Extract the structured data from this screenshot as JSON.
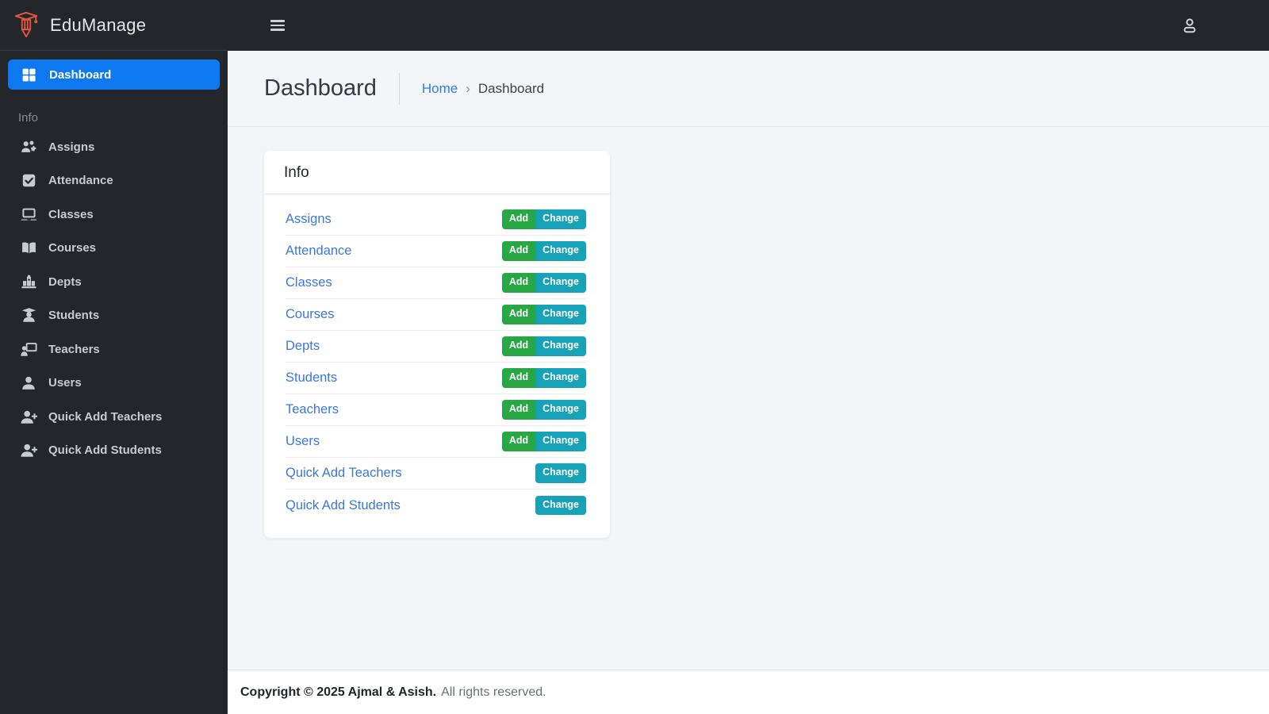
{
  "brand": {
    "name": "EduManage"
  },
  "sidebar": {
    "dashboard": {
      "label": "Dashboard"
    },
    "section_label": "Info",
    "items": [
      {
        "label": "Assigns"
      },
      {
        "label": "Attendance"
      },
      {
        "label": "Classes"
      },
      {
        "label": "Courses"
      },
      {
        "label": "Depts"
      },
      {
        "label": "Students"
      },
      {
        "label": "Teachers"
      },
      {
        "label": "Users"
      },
      {
        "label": "Quick Add Teachers"
      },
      {
        "label": "Quick Add Students"
      }
    ]
  },
  "content_header": {
    "title": "Dashboard",
    "breadcrumb": {
      "home": "Home",
      "separator": "›",
      "current": "Dashboard"
    }
  },
  "card": {
    "title": "Info",
    "add_label": "Add",
    "change_label": "Change",
    "rows": [
      {
        "label": "Assigns",
        "actions": [
          "Add",
          "Change"
        ]
      },
      {
        "label": "Attendance",
        "actions": [
          "Add",
          "Change"
        ]
      },
      {
        "label": "Classes",
        "actions": [
          "Add",
          "Change"
        ]
      },
      {
        "label": "Courses",
        "actions": [
          "Add",
          "Change"
        ]
      },
      {
        "label": "Depts",
        "actions": [
          "Add",
          "Change"
        ]
      },
      {
        "label": "Students",
        "actions": [
          "Add",
          "Change"
        ]
      },
      {
        "label": "Teachers",
        "actions": [
          "Add",
          "Change"
        ]
      },
      {
        "label": "Users",
        "actions": [
          "Add",
          "Change"
        ]
      },
      {
        "label": "Quick Add Teachers",
        "actions": [
          "Change"
        ]
      },
      {
        "label": "Quick Add Students",
        "actions": [
          "Change"
        ]
      }
    ]
  },
  "footer": {
    "copyright": "Copyright © 2025 Ajmal & Asish.",
    "rights": "All rights reserved."
  },
  "colors": {
    "accent_blue": "#0d78f0",
    "add_green": "#28a745",
    "change_teal": "#17a2b8",
    "link_blue": "#3c77dd",
    "sidebar_bg": "#23272b",
    "content_bg": "#f3f5f8",
    "logo_orange": "#e2573b"
  }
}
